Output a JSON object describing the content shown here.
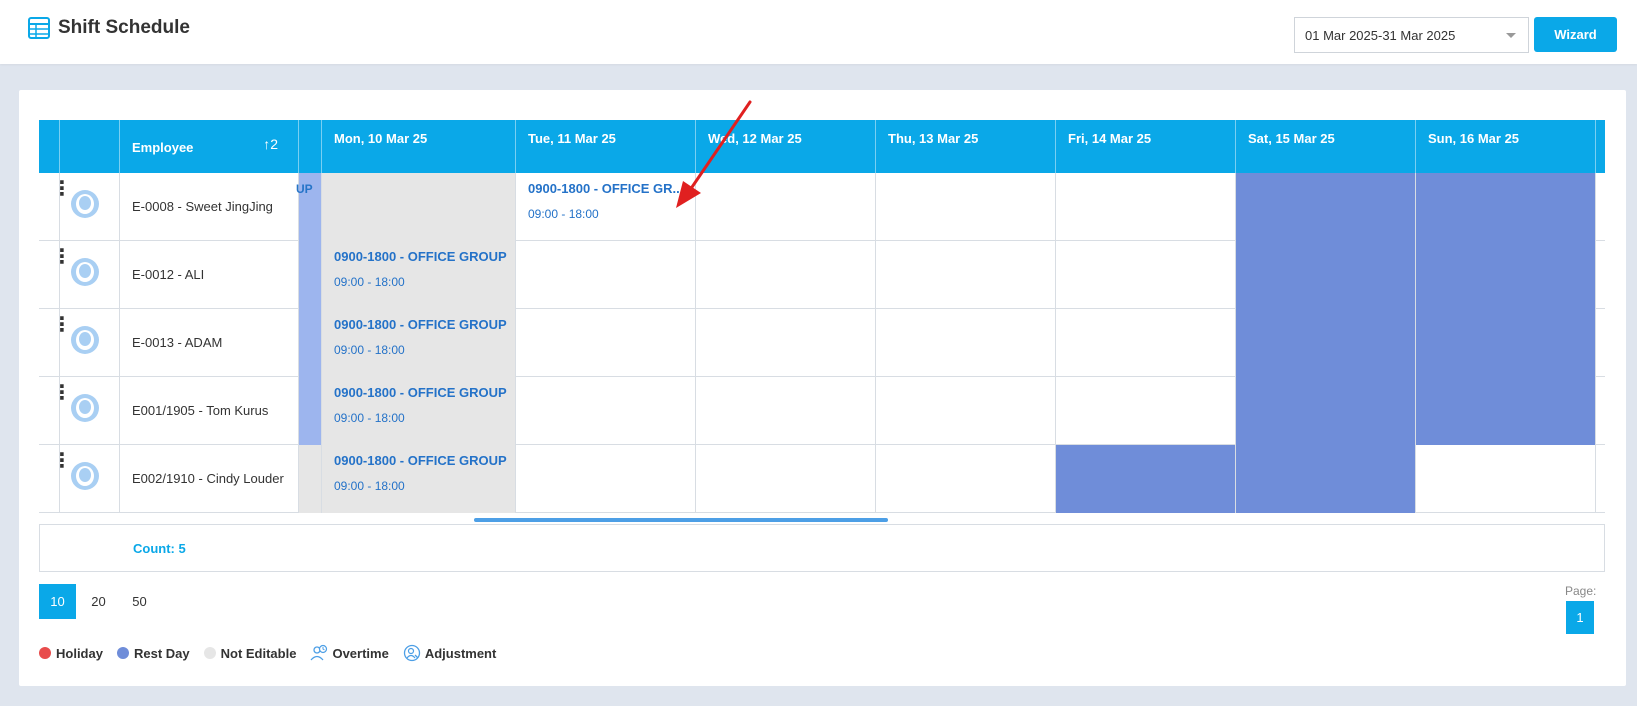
{
  "header": {
    "title": "Shift Schedule",
    "date_range": "01 Mar 2025-31 Mar 2025",
    "wizard_label": "Wizard"
  },
  "table": {
    "employee_header": "Employee",
    "sort_icon": "↑2",
    "days": [
      "Mon, 10 Mar 25",
      "Tue, 11 Mar 25",
      "Wed, 12 Mar 25",
      "Thu, 13 Mar 25",
      "Fri, 14 Mar 25",
      "Sat, 15 Mar 25",
      "Sun, 16 Mar 25"
    ],
    "strip_text": "UP",
    "rows": [
      {
        "name": "E-0008 - Sweet JingJing",
        "shift_name": "0900-1800 - OFFICE GR...",
        "shift_time": "09:00 - 18:00"
      },
      {
        "name": "E-0012 - ALI",
        "shift_name": "0900-1800 - OFFICE GROUP",
        "shift_time": "09:00 - 18:00"
      },
      {
        "name": "E-0013 - ADAM",
        "shift_name": "0900-1800 - OFFICE GROUP",
        "shift_time": "09:00 - 18:00"
      },
      {
        "name": "E001/1905 - Tom Kurus",
        "shift_name": "0900-1800 - OFFICE GROUP",
        "shift_time": "09:00 - 18:00"
      },
      {
        "name": "E002/1910 - Cindy Louder",
        "shift_name": "0900-1800 - OFFICE GROUP",
        "shift_time": "09:00 - 18:00"
      }
    ],
    "count": "Count: 5"
  },
  "pager": {
    "sizes": [
      "10",
      "20",
      "50"
    ],
    "page_label": "Page:",
    "current_page": "1"
  },
  "legend": {
    "holiday": "Holiday",
    "rest_day": "Rest Day",
    "not_editable": "Not Editable",
    "overtime": "Overtime",
    "adjustment": "Adjustment"
  },
  "colors": {
    "accent": "#0aa8e8",
    "rest_day": "#6f8dd9",
    "holiday": "#e84c4c",
    "not_editable": "#e6e6e6",
    "shift_text": "#2472c8"
  }
}
